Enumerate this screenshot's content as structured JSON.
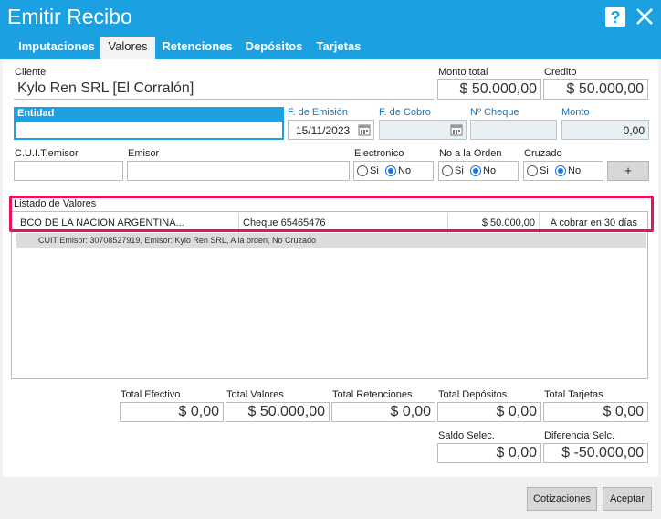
{
  "window": {
    "title": "Emitir Recibo",
    "help_label": "?"
  },
  "tabs": [
    {
      "label": "Imputaciones"
    },
    {
      "label": "Valores"
    },
    {
      "label": "Retenciones"
    },
    {
      "label": "Depósitos"
    },
    {
      "label": "Tarjetas"
    }
  ],
  "header": {
    "cliente_label": "Cliente",
    "cliente_value": "Kylo Ren SRL [El Corralón]",
    "monto_total_label": "Monto total",
    "monto_total_value": "$ 50.000,00",
    "credito_label": "Credito",
    "credito_value": "$ 50.000,00"
  },
  "cheque": {
    "entidad_label": "Entidad",
    "entidad_value": "",
    "f_emision_label": "F. de Emisión",
    "f_emision_value": "15/11/2023",
    "f_cobro_label": "F. de Cobro",
    "f_cobro_value": "",
    "nro_cheque_label": "Nº Cheque",
    "nro_cheque_value": "",
    "monto_label": "Monto",
    "monto_value": "0,00",
    "cuit_label": "C.U.I.T.emisor",
    "cuit_value": "",
    "emisor_label": "Emisor",
    "emisor_value": "",
    "electronico_label": "Electronico",
    "no_orden_label": "No a la Orden",
    "cruzado_label": "Cruzado",
    "si_label": "Si",
    "no_label": "No",
    "add_label": "+"
  },
  "listado": {
    "label": "Listado de Valores",
    "rows": [
      {
        "banco": "BCO DE LA NACION ARGENTINA...",
        "tipo": "Cheque 65465476",
        "monto": "$ 50.000,00",
        "estado": "A cobrar en 30 días",
        "detalle": "CUIT Emisor: 30708527919, Emisor: Kylo Ren SRL, A la orden, No Cruzado"
      }
    ]
  },
  "totales": {
    "efectivo_label": "Total Efectivo",
    "efectivo_value": "$ 0,00",
    "valores_label": "Total Valores",
    "valores_value": "$ 50.000,00",
    "retenciones_label": "Total Retenciones",
    "retenciones_value": "$ 0,00",
    "depositos_label": "Total Depósitos",
    "depositos_value": "$ 0,00",
    "tarjetas_label": "Total Tarjetas",
    "tarjetas_value": "$ 0,00",
    "saldo_label": "Saldo Selec.",
    "saldo_value": "$ 0,00",
    "diferencia_label": "Diferencia Selc.",
    "diferencia_value": "$ -50.000,00"
  },
  "footer": {
    "cotizaciones_label": "Cotizaciones",
    "aceptar_label": "Aceptar"
  },
  "colors": {
    "titlebar": "#1ba1e2",
    "highlight": "#e6125f",
    "radio_selected": "#1a73e8"
  }
}
